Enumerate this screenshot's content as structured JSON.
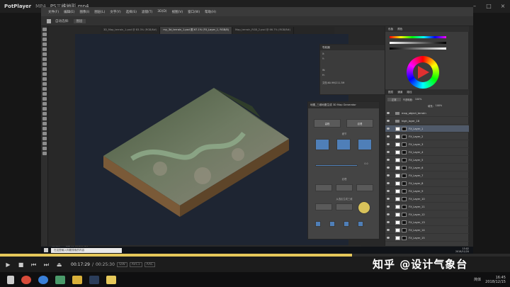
{
  "player": {
    "app": "PotPlayer",
    "format": "MP4",
    "file": "PS三维地形.mp4",
    "time_current": "00:17:29",
    "time_total": "00:25:30",
    "tags": [
      "S/W",
      "AVC1",
      "AAC"
    ],
    "progress": 0.69,
    "buttons": [
      "play",
      "stop",
      "prev",
      "next",
      "open"
    ]
  },
  "ps": {
    "menu": [
      "文件(F)",
      "编辑(E)",
      "图像(I)",
      "图层(L)",
      "文字(Y)",
      "选择(S)",
      "滤镜(T)",
      "3D(D)",
      "视图(V)",
      "窗口(W)",
      "帮助(H)"
    ],
    "options": [
      "自动选择:",
      "图层"
    ],
    "tabs": [
      "3D_Map_terrain_1.psd @ 83.3% (RGB/8#)",
      "my_3d_terrain_1.psd 图 67.1% (FX_Layer_1, RGB/8)",
      "Map_terrain_RGB_2.psd @ 66.7% (RGB/8#)"
    ],
    "status": [
      "67.78%",
      "文档:60.9M/211.3M"
    ],
    "navigator": {
      "title": "导航器",
      "values": [
        "X:",
        "Y:",
        "W:",
        "H:",
        "文档:60.9M/211.3M"
      ]
    },
    "plugin": {
      "title": "地图_三维地图生成 3D Map Generator",
      "tabs": [
        "高程",
        "纹理"
      ],
      "sections": [
        "细节",
        "纹理",
        "从选区生成三维"
      ],
      "values": [
        "0.0",
        "10"
      ]
    },
    "panels": {
      "top": [
        "色板",
        "颜色"
      ],
      "layers_tabs": [
        "图层",
        "通道",
        "路径"
      ],
      "blend": "正常",
      "opacity_label": "不透明度:",
      "opacity": "100%",
      "fill_label": "填充:",
      "fill": "100%"
    },
    "layers": [
      {
        "name": "map_object_terrain",
        "group": true
      },
      {
        "name": "high_layer_18",
        "group": true
      },
      {
        "name": "FX_Layer_1",
        "selected": true
      },
      {
        "name": "FX_Layer_2"
      },
      {
        "name": "FX_Layer_3"
      },
      {
        "name": "FX_Layer_4"
      },
      {
        "name": "FX_Layer_5"
      },
      {
        "name": "FX_Layer_6"
      },
      {
        "name": "FX_Layer_7"
      },
      {
        "name": "FX_Layer_8"
      },
      {
        "name": "FX_Layer_9"
      },
      {
        "name": "FX_Layer_10"
      },
      {
        "name": "FX_Layer_11"
      },
      {
        "name": "FX_Layer_12"
      },
      {
        "name": "FX_Layer_13"
      },
      {
        "name": "FX_Layer_14"
      },
      {
        "name": "FX_Layer_15"
      }
    ]
  },
  "inner_taskbar": {
    "search": "在这里输入你要搜索的内容",
    "time": "15:02",
    "date": "2018/11/20"
  },
  "taskbar": {
    "time": "16:45",
    "date": "2018/12/15",
    "lang": "简体"
  },
  "watermark": "知乎 @设计气象台",
  "colors": {
    "accent": "#e6c85a",
    "selection": "#505a6a"
  }
}
